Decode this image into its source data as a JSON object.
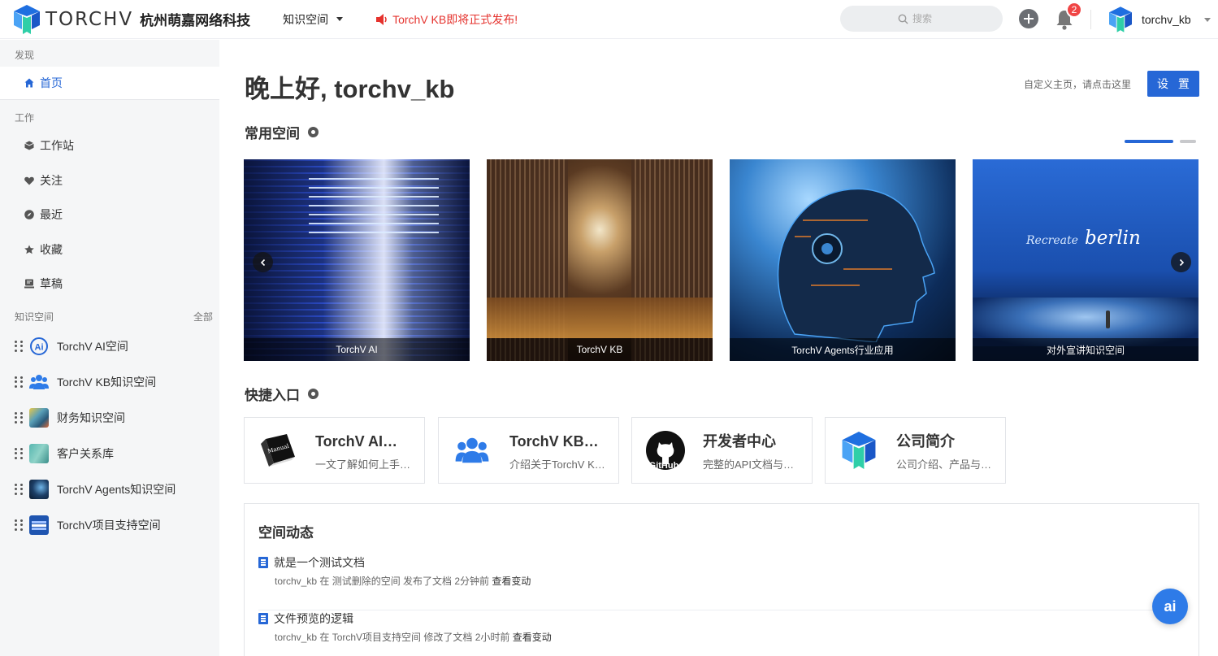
{
  "header": {
    "brand_word": "TORCHV",
    "brand_cn": "杭州萌嘉网络科技",
    "nav_label": "知识空间",
    "announcement": "TorchV KB即将正式发布!",
    "search_placeholder": "搜索",
    "notification_count": "2",
    "username": "torchv_kb"
  },
  "sidebar": {
    "group_discover": "发现",
    "home": "首页",
    "group_work": "工作",
    "work_items": [
      "工作站",
      "关注",
      "最近",
      "收藏",
      "草稿"
    ],
    "group_spaces": "知识空间",
    "all_link": "全部",
    "spaces": [
      "TorchV AI空间",
      "TorchV KB知识空间",
      "财务知识空间",
      "客户关系库",
      "TorchV Agents知识空间",
      "TorchV项目支持空间"
    ]
  },
  "main": {
    "greeting": "晚上好, torchv_kb",
    "customize_tip": "自定义主页，请点击这里",
    "settings_label": "设 置",
    "frequent_title": "常用空间",
    "cards": [
      "TorchV AI",
      "TorchV KB",
      "TorchV Agents行业应用",
      "对外宣讲知识空间"
    ],
    "card4_overlay_text": {
      "recreate": "Recreate",
      "berlin": "berlin"
    },
    "quick_title": "快捷入口",
    "quick": [
      {
        "title": "TorchV AI使用手册",
        "desc": "一文了解如何上手使用"
      },
      {
        "title": "TorchV KB知识空间",
        "desc": "介绍关于TorchV KB的知识"
      },
      {
        "title": "开发者中心",
        "desc": "完整的API文档与开发资源"
      },
      {
        "title": "公司简介",
        "desc": "公司介绍、产品与服务"
      }
    ],
    "quick_icon_text": {
      "manual": "Manual",
      "github": "GitHub"
    },
    "feed_title": "空间动态",
    "feed": [
      {
        "title": "就是一个测试文档",
        "meta": "torchv_kb 在 测试删除的空间 发布了文档 2分钟前",
        "action": "查看变动"
      },
      {
        "title": "文件预览的逻辑",
        "meta": "torchv_kb 在 TorchV项目支持空间 修改了文档 2小时前",
        "action": "查看变动"
      }
    ],
    "ai_button": "ai"
  },
  "colors": {
    "brand_blue": "#2667d6",
    "announce_red": "#e5322d",
    "badge_red": "#f04545"
  }
}
